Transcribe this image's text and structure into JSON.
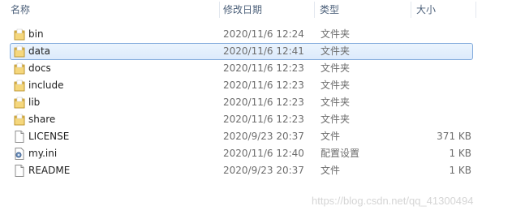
{
  "columns": {
    "name": "名称",
    "modified": "修改日期",
    "type": "类型",
    "size": "大小"
  },
  "files": [
    {
      "name": "bin",
      "modified": "2020/11/6 12:24",
      "type": "文件夹",
      "size": "",
      "icon": "folder-icon",
      "selected": false
    },
    {
      "name": "data",
      "modified": "2020/11/6 12:41",
      "type": "文件夹",
      "size": "",
      "icon": "folder-icon",
      "selected": true
    },
    {
      "name": "docs",
      "modified": "2020/11/6 12:23",
      "type": "文件夹",
      "size": "",
      "icon": "folder-icon",
      "selected": false
    },
    {
      "name": "include",
      "modified": "2020/11/6 12:23",
      "type": "文件夹",
      "size": "",
      "icon": "folder-icon",
      "selected": false
    },
    {
      "name": "lib",
      "modified": "2020/11/6 12:23",
      "type": "文件夹",
      "size": "",
      "icon": "folder-icon",
      "selected": false
    },
    {
      "name": "share",
      "modified": "2020/11/6 12:23",
      "type": "文件夹",
      "size": "",
      "icon": "folder-icon",
      "selected": false
    },
    {
      "name": "LICENSE",
      "modified": "2020/9/23 20:37",
      "type": "文件",
      "size": "371 KB",
      "icon": "file-icon",
      "selected": false
    },
    {
      "name": "my.ini",
      "modified": "2020/11/6 12:40",
      "type": "配置设置",
      "size": "1 KB",
      "icon": "settings-file-icon",
      "selected": false
    },
    {
      "name": "README",
      "modified": "2020/9/23 20:37",
      "type": "文件",
      "size": "1 KB",
      "icon": "file-icon",
      "selected": false
    }
  ],
  "watermark": "https://blog.csdn.net/qq_41300494",
  "colors": {
    "selection_border": "#84acdd",
    "selection_fill": "#dceafc",
    "folder": "#e8c35a",
    "header_text": "#4c607a"
  }
}
